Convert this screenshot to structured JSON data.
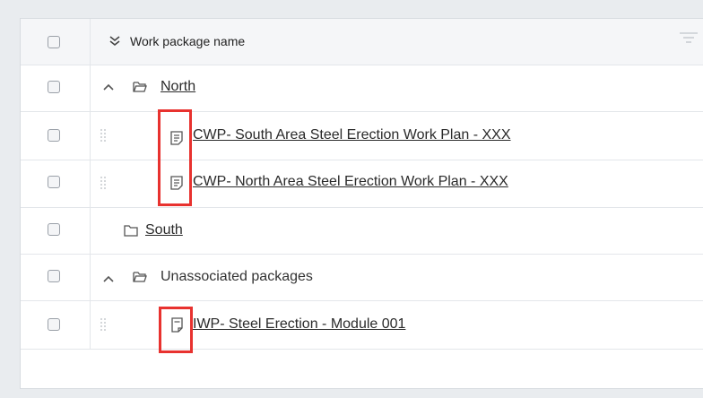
{
  "table": {
    "header": {
      "column_name": "Work package name"
    },
    "rows": [
      {
        "label": "North"
      },
      {
        "label": "CWP- South Area Steel Erection Work Plan - XXX"
      },
      {
        "label": "CWP- North Area Steel Erection Work Plan - XXX"
      },
      {
        "label": "South"
      },
      {
        "label": "Unassociated packages"
      },
      {
        "label": "IWP- Steel Erection - Module 001"
      }
    ]
  },
  "colors": {
    "highlight": "#e8322f",
    "link_text": "#2a2a2a"
  }
}
